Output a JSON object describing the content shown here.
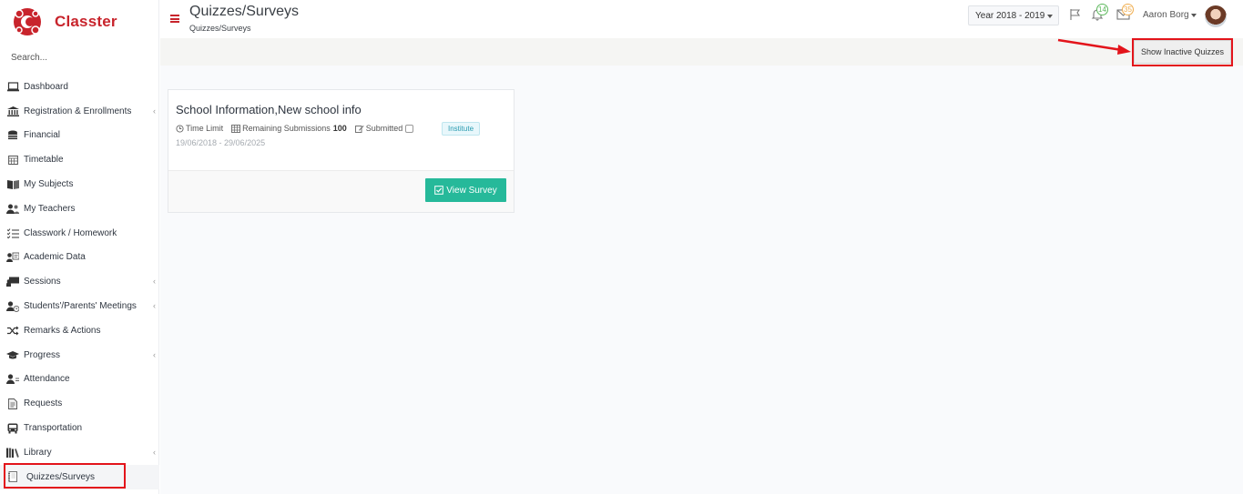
{
  "brand": {
    "name": "Classter",
    "color": "#c8242c"
  },
  "search": {
    "placeholder": "Search..."
  },
  "sidebar": {
    "items": [
      {
        "label": "Dashboard",
        "icon": "laptop-icon",
        "submenu": false
      },
      {
        "label": "Registration & Enrollments",
        "icon": "bank-icon",
        "submenu": true
      },
      {
        "label": "Financial",
        "icon": "coins-icon",
        "submenu": false
      },
      {
        "label": "Timetable",
        "icon": "calendar-icon",
        "submenu": false
      },
      {
        "label": "My Subjects",
        "icon": "book-icon",
        "submenu": false
      },
      {
        "label": "My Teachers",
        "icon": "users-icon",
        "submenu": false
      },
      {
        "label": "Classwork / Homework",
        "icon": "list-check-icon",
        "submenu": false
      },
      {
        "label": "Academic Data",
        "icon": "user-card-icon",
        "submenu": false
      },
      {
        "label": "Sessions",
        "icon": "presentation-icon",
        "submenu": true
      },
      {
        "label": "Students'/Parents' Meetings",
        "icon": "user-clock-icon",
        "submenu": true
      },
      {
        "label": "Remarks & Actions",
        "icon": "shuffle-icon",
        "submenu": false
      },
      {
        "label": "Progress",
        "icon": "graduation-cap-icon",
        "submenu": true
      },
      {
        "label": "Attendance",
        "icon": "user-list-icon",
        "submenu": false
      },
      {
        "label": "Requests",
        "icon": "document-icon",
        "submenu": false
      },
      {
        "label": "Transportation",
        "icon": "bus-icon",
        "submenu": false
      },
      {
        "label": "Library",
        "icon": "books-icon",
        "submenu": true
      },
      {
        "label": "Quizzes/Surveys",
        "icon": "notebook-icon",
        "submenu": false,
        "active": true
      }
    ]
  },
  "header": {
    "title": "Quizzes/Surveys",
    "breadcrumb": "Quizzes/Surveys",
    "year": "Year 2018 - 2019",
    "notifications": {
      "count": "14",
      "color": "#5cb85c"
    },
    "messages": {
      "count": "35",
      "color": "#f0ad4e"
    },
    "user": "Aaron Borg"
  },
  "toolbar": {
    "inactive_label": "Show Inactive Quizzes"
  },
  "card": {
    "title": "School Information,New school info",
    "time_limit": "Time Limit",
    "remaining_label": "Remaining Submissions",
    "remaining_value": "100",
    "submitted_label": "Submitted",
    "tag": "Institute",
    "dates": "19/06/2018 - 29/06/2025",
    "view_label": "View Survey"
  },
  "colors": {
    "accent": "#26b99a",
    "highlight": "#e3141b"
  }
}
